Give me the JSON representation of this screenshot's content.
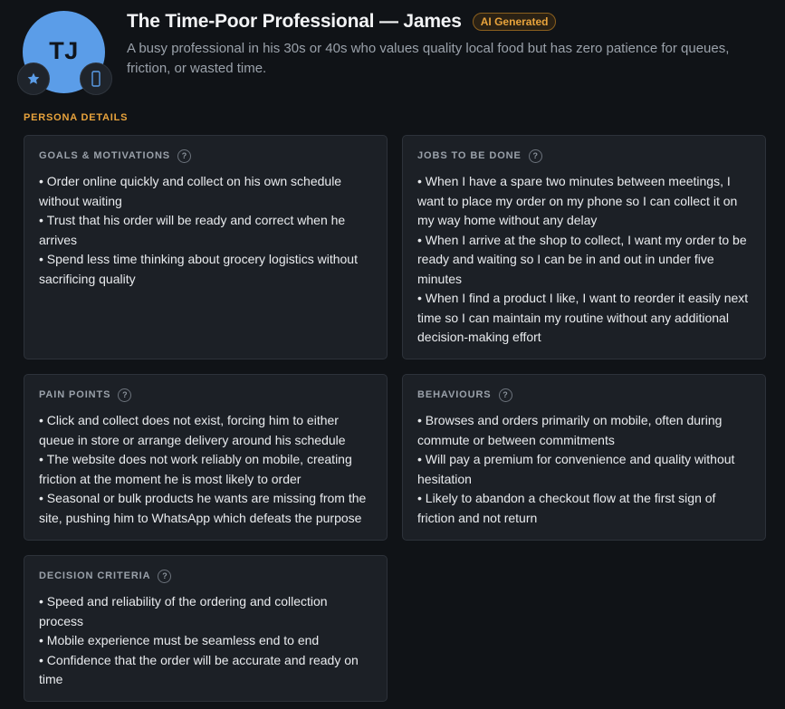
{
  "persona": {
    "initials": "TJ",
    "title": "The Time-Poor Professional — James",
    "badge": "AI Generated",
    "description": "A busy professional in his 30s or 40s who values quality local food but has zero patience for queues, friction, or wasted time."
  },
  "icons": {
    "star": "star-icon",
    "mobile": "mobile-phone-icon",
    "help": "help-icon"
  },
  "section_label": "PERSONA DETAILS",
  "help_glyph": "?",
  "cards": [
    {
      "title": "GOALS & MOTIVATIONS",
      "items": [
        "Order online quickly and collect on his own schedule without waiting",
        "Trust that his order will be ready and correct when he arrives",
        "Spend less time thinking about grocery logistics without sacrificing quality"
      ]
    },
    {
      "title": "JOBS TO BE DONE",
      "items": [
        "When I have a spare two minutes between meetings, I want to place my order on my phone so I can collect it on my way home without any delay",
        "When I arrive at the shop to collect, I want my order to be ready and waiting so I can be in and out in under five minutes",
        "When I find a product I like, I want to reorder it easily next time so I can maintain my routine without any additional decision-making effort"
      ]
    },
    {
      "title": "PAIN POINTS",
      "items": [
        "Click and collect does not exist, forcing him to either queue in store or arrange delivery around his schedule",
        "The website does not work reliably on mobile, creating friction at the moment he is most likely to order",
        "Seasonal or bulk products he wants are missing from the site, pushing him to WhatsApp which defeats the purpose"
      ]
    },
    {
      "title": "BEHAVIOURS",
      "items": [
        "Browses and orders primarily on mobile, often during commute or between commitments",
        "Will pay a premium for convenience and quality without hesitation",
        "Likely to abandon a checkout flow at the first sign of friction and not return"
      ]
    },
    {
      "title": "DECISION CRITERIA",
      "items": [
        "Speed and reliability of the ordering and collection process",
        "Mobile experience must be seamless end to end",
        "Confidence that the order will be accurate and ready on time"
      ]
    }
  ],
  "colors": {
    "background": "#101317",
    "card": "#1c2026",
    "accent": "#e8a33c",
    "avatar": "#5b9de8"
  }
}
